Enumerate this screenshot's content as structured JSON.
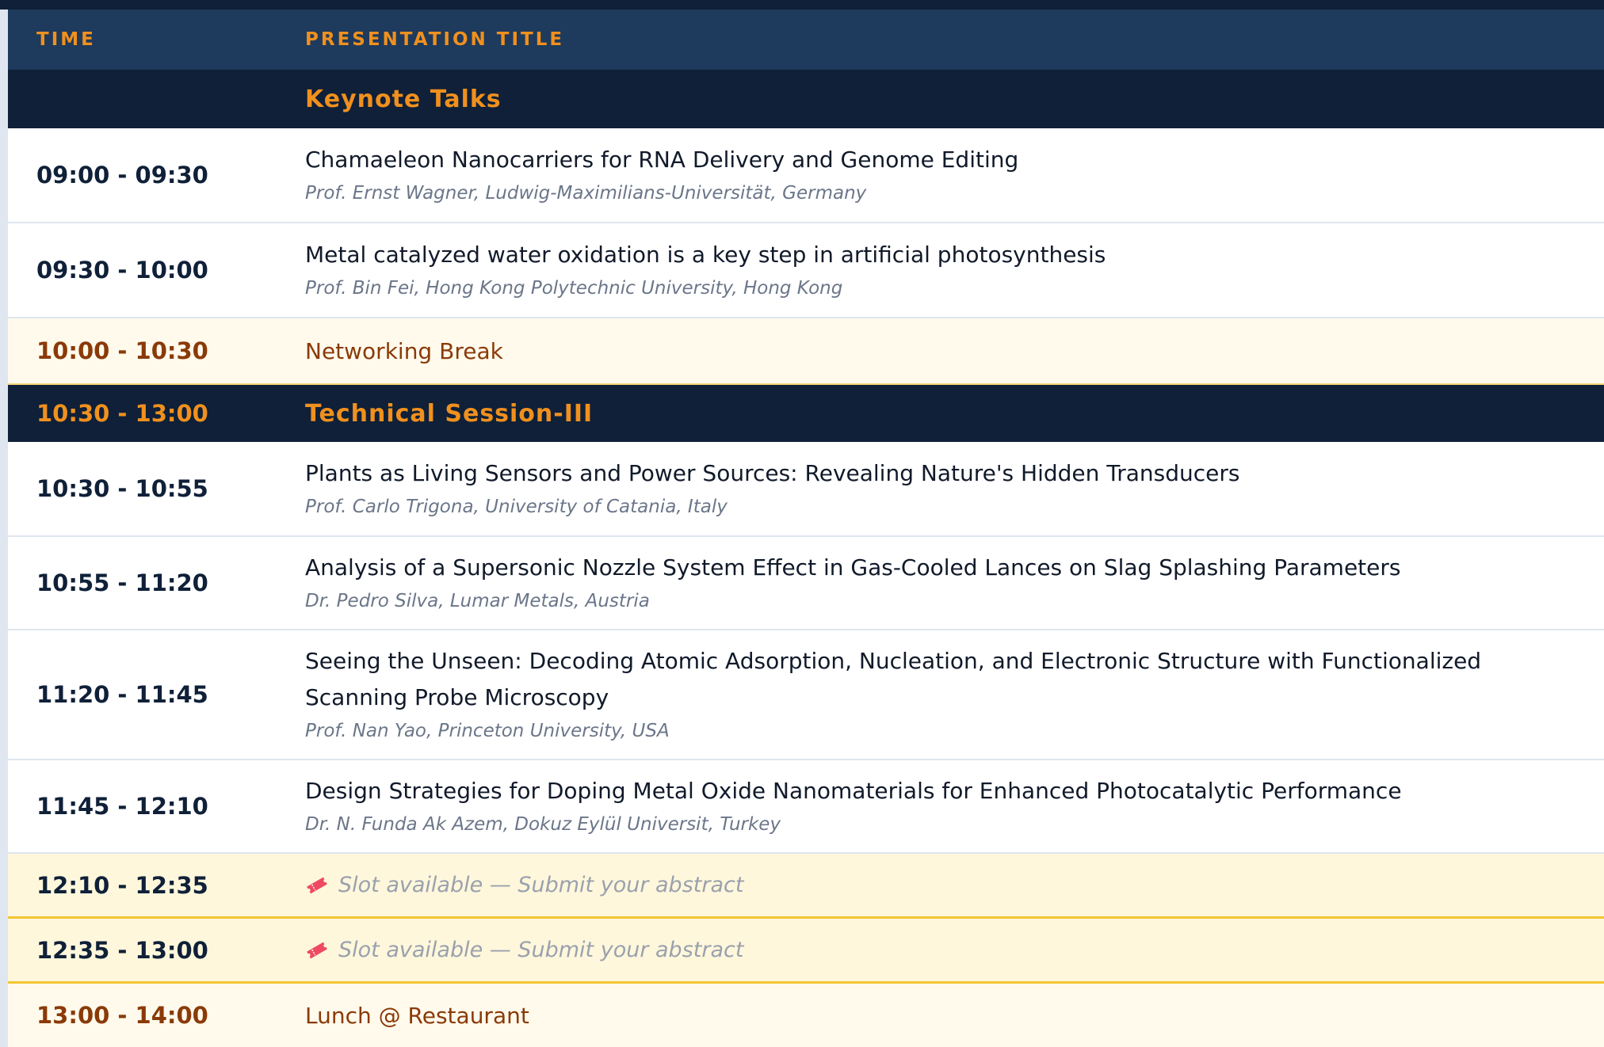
{
  "header": {
    "time_label": "TIME",
    "title_label": "PRESENTATION TITLE"
  },
  "rows": [
    {
      "kind": "section",
      "time": "",
      "title": "Keynote Talks"
    },
    {
      "kind": "talk",
      "time": "09:00 - 09:30",
      "title": "Chamaeleon Nanocarriers for RNA Delivery and Genome Editing",
      "speaker": "Prof. Ernst Wagner, Ludwig-Maximilians-Universität, Germany"
    },
    {
      "kind": "talk",
      "time": "09:30 - 10:00",
      "title": "Metal catalyzed water oxidation is a key step in artificial photosynthesis",
      "speaker": "Prof. Bin Fei, Hong Kong Polytechnic University, Hong Kong"
    },
    {
      "kind": "break",
      "time": "10:00 - 10:30",
      "title": "Networking Break"
    },
    {
      "kind": "section",
      "time": "10:30 - 13:00",
      "title": "Technical Session-III"
    },
    {
      "kind": "talk",
      "time": "10:30 - 10:55",
      "title": "Plants as Living Sensors and Power Sources: Revealing Nature's Hidden Transducers",
      "speaker": "Prof. Carlo Trigona, University of Catania, Italy"
    },
    {
      "kind": "talk",
      "time": "10:55 - 11:20",
      "title": "Analysis of a Supersonic Nozzle System Effect in Gas-Cooled Lances on Slag Splashing Parameters",
      "speaker": "Dr. Pedro Silva, Lumar Metals, Austria"
    },
    {
      "kind": "talk",
      "time": "11:20 - 11:45",
      "title": "Seeing the Unseen: Decoding Atomic Adsorption, Nucleation, and Electronic Structure with Functionalized Scanning Probe Microscopy",
      "speaker": "Prof. Nan Yao, Princeton University, USA"
    },
    {
      "kind": "talk",
      "time": "11:45 - 12:10",
      "title": "Design Strategies for Doping Metal Oxide Nanomaterials for Enhanced Photocatalytic Performance",
      "speaker": "Dr. N. Funda Ak Azem, Dokuz Eylül Universit, Turkey"
    },
    {
      "kind": "slot",
      "time": "12:10 - 12:35",
      "title": "Slot available — Submit your abstract",
      "icon": "ticket-icon"
    },
    {
      "kind": "slot",
      "time": "12:35 - 13:00",
      "title": "Slot available — Submit your abstract",
      "icon": "ticket-icon"
    },
    {
      "kind": "break",
      "time": "13:00 - 14:00",
      "title": "Lunch @ Restaurant"
    }
  ],
  "colors": {
    "navy": "#0f2038",
    "header_blue": "#1e3a5c",
    "accent_orange": "#f0901e",
    "break_brown": "#8a3a08",
    "slot_bg": "#fff7dc",
    "break_bg": "#fffaec"
  }
}
